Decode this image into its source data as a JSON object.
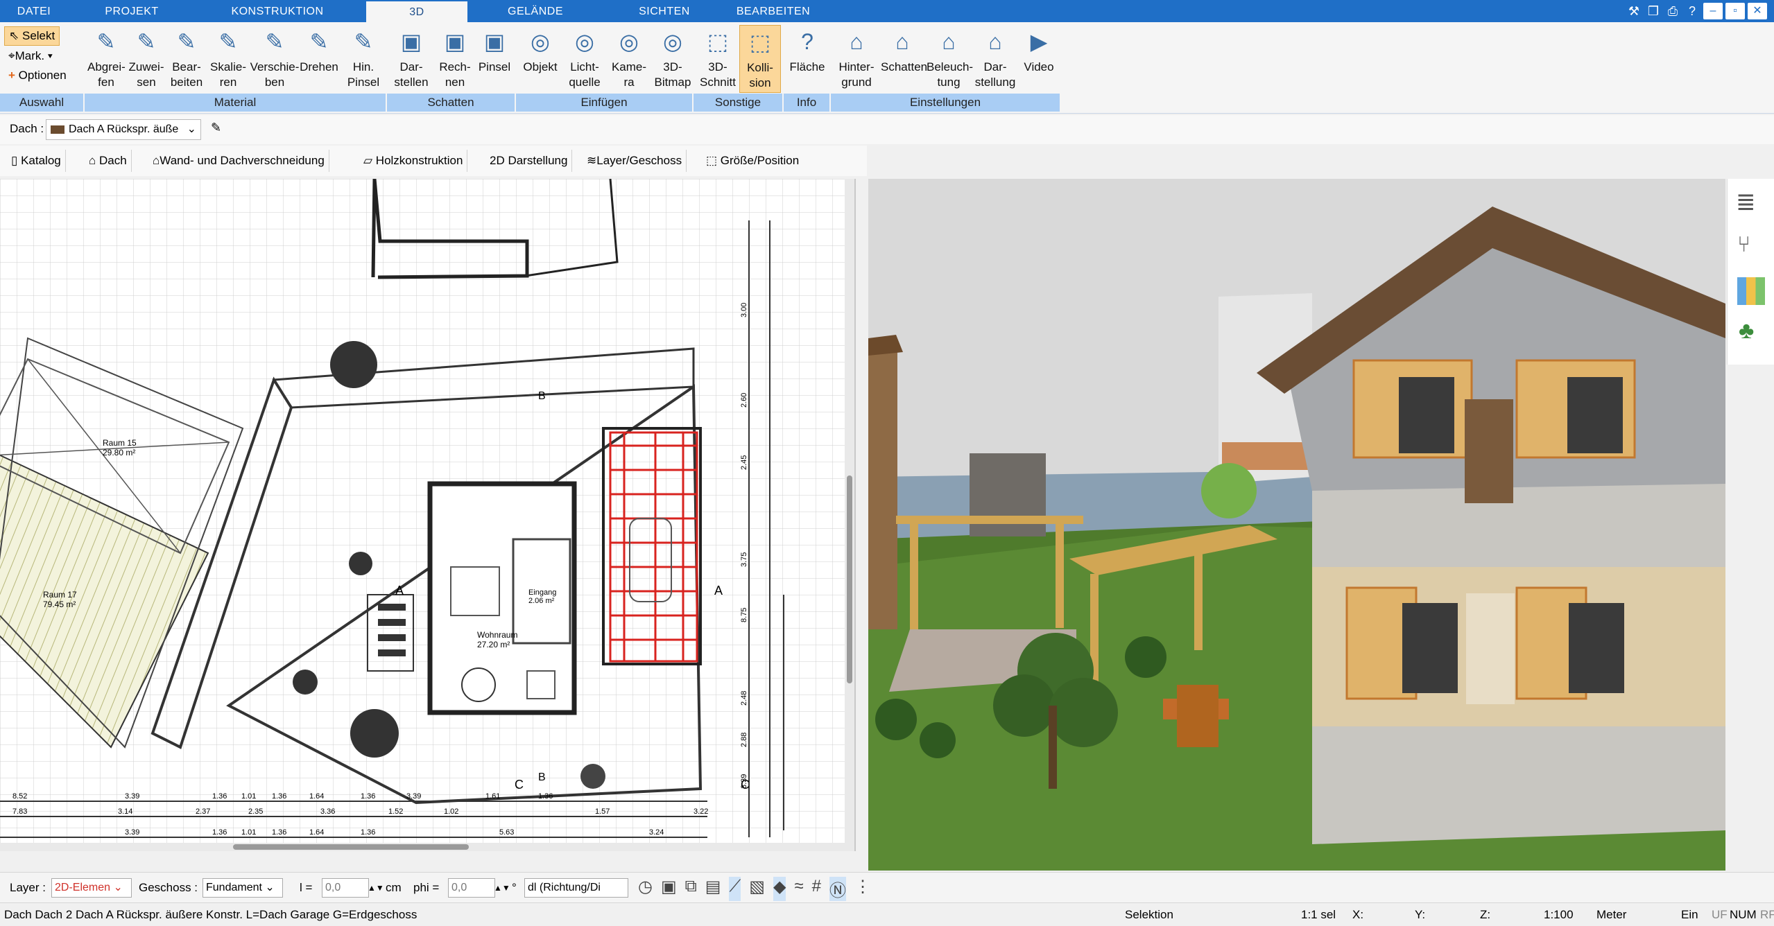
{
  "tabs": [
    {
      "label": "DATEI"
    },
    {
      "label": "PROJEKT"
    },
    {
      "label": "KONSTRUKTION"
    },
    {
      "label": "3D"
    },
    {
      "label": "GELÄNDE"
    },
    {
      "label": "SICHTEN"
    },
    {
      "label": "BEARBEITEN"
    }
  ],
  "ribbon": {
    "auswahl": {
      "selekt": "Selekt",
      "mark": "Mark.",
      "optionen": "Optionen",
      "group": "Auswahl"
    },
    "material": {
      "group": "Material",
      "buttons": [
        {
          "l1": "Abgrei-",
          "l2": "fen"
        },
        {
          "l1": "Zuwei-",
          "l2": "sen"
        },
        {
          "l1": "Bear-",
          "l2": "beiten"
        },
        {
          "l1": "Skalie-",
          "l2": "ren"
        },
        {
          "l1": "Verschie-",
          "l2": "ben"
        },
        {
          "l1": "Drehen",
          "l2": ""
        },
        {
          "l1": "Hin.",
          "l2": "Pinsel"
        }
      ]
    },
    "schatten": {
      "group": "Schatten",
      "buttons": [
        {
          "l1": "Dar-",
          "l2": "stellen"
        },
        {
          "l1": "Rech-",
          "l2": "nen"
        },
        {
          "l1": "Pinsel",
          "l2": ""
        }
      ]
    },
    "einfuegen": {
      "group": "Einfügen",
      "buttons": [
        {
          "l1": "Objekt",
          "l2": ""
        },
        {
          "l1": "Licht-",
          "l2": "quelle"
        },
        {
          "l1": "Kame-",
          "l2": "ra"
        },
        {
          "l1": "3D-",
          "l2": "Bitmap"
        }
      ]
    },
    "sonstige": {
      "group": "Sonstige",
      "buttons": [
        {
          "l1": "3D-",
          "l2": "Schnitt"
        },
        {
          "l1": "Kolli-",
          "l2": "sion"
        }
      ]
    },
    "info": {
      "group": "Info",
      "buttons": [
        {
          "l1": "Fläche",
          "l2": ""
        }
      ]
    },
    "einstellungen": {
      "group": "Einstellungen",
      "buttons": [
        {
          "l1": "Hinter-",
          "l2": "grund"
        },
        {
          "l1": "Schatten",
          "l2": ""
        },
        {
          "l1": "Beleuch-",
          "l2": "tung"
        },
        {
          "l1": "Dar-",
          "l2": "stellung"
        },
        {
          "l1": "Video",
          "l2": ""
        }
      ]
    }
  },
  "propbar": {
    "label": "Dach :",
    "value": "Dach A Rückspr. äuße"
  },
  "subbar": [
    {
      "label": "Katalog"
    },
    {
      "label": "Dach"
    },
    {
      "label": "Wand- und Dachverschneidung"
    },
    {
      "label": "Holzkonstruktion"
    },
    {
      "label": "2D Darstellung"
    },
    {
      "label": "Layer/Geschoss"
    },
    {
      "label": "Größe/Position"
    }
  ],
  "plan": {
    "rooms": [
      {
        "name": "Raum 15",
        "area": "29.80 m²"
      },
      {
        "name": "Raum 17",
        "area": "79.45 m²"
      },
      {
        "name": "Wohnraum",
        "area": "27.20 m²"
      },
      {
        "name": "Eingang",
        "area": "2.06 m²"
      }
    ],
    "section_markers": [
      "A",
      "A",
      "B",
      "B",
      "C",
      "C"
    ],
    "dims_row1": [
      "8.52",
      "3.39",
      "1.36",
      "1.01",
      "1.36",
      "1.64",
      "1.36",
      "3.39",
      "1.61",
      "1.36"
    ],
    "dims_row2": [
      "7.83",
      "3.14",
      "2.37",
      "2.35",
      "3.36",
      "1.52",
      "1.02",
      "1.57",
      "3.22"
    ],
    "dims_row3": [
      "3.39",
      "1.36",
      "1.01",
      "1.36",
      "1.64",
      "1.36",
      "5.63",
      "3.24"
    ],
    "dims_vertical": [
      "3.00",
      "2.60",
      "2.45",
      "3.75",
      "8.75",
      "2.48",
      "2.88",
      "3.39"
    ]
  },
  "bottombar": {
    "layer_label": "Layer :",
    "layer_value": "2D-Elemen",
    "geschoss_label": "Geschoss :",
    "geschoss_value": "Fundament",
    "l_label": "l =",
    "l_value": "0,0",
    "l_unit": "cm",
    "phi_label": "phi =",
    "phi_value": "0,0",
    "phi_unit": "°",
    "dl_value": "dl (Richtung/Di"
  },
  "statusbar": {
    "left": "Dach Dach 2  Dach A Rückspr. äußere Konstr. L=Dach Garage G=Erdgeschoss",
    "mode": "Selektion",
    "sel": "1:1 sel",
    "x": "X:",
    "y": "Y:",
    "z": "Z:",
    "scale": "1:100",
    "unit": "Meter",
    "ein": "Ein",
    "uf": "UF",
    "num": "NUM",
    "rf": "RF"
  },
  "colors": {
    "ribbon_blue": "#1f6fc7",
    "group_label": "#a9cdf4",
    "selected_tool": "#fbd79a",
    "garage_red": "#d8231f"
  }
}
